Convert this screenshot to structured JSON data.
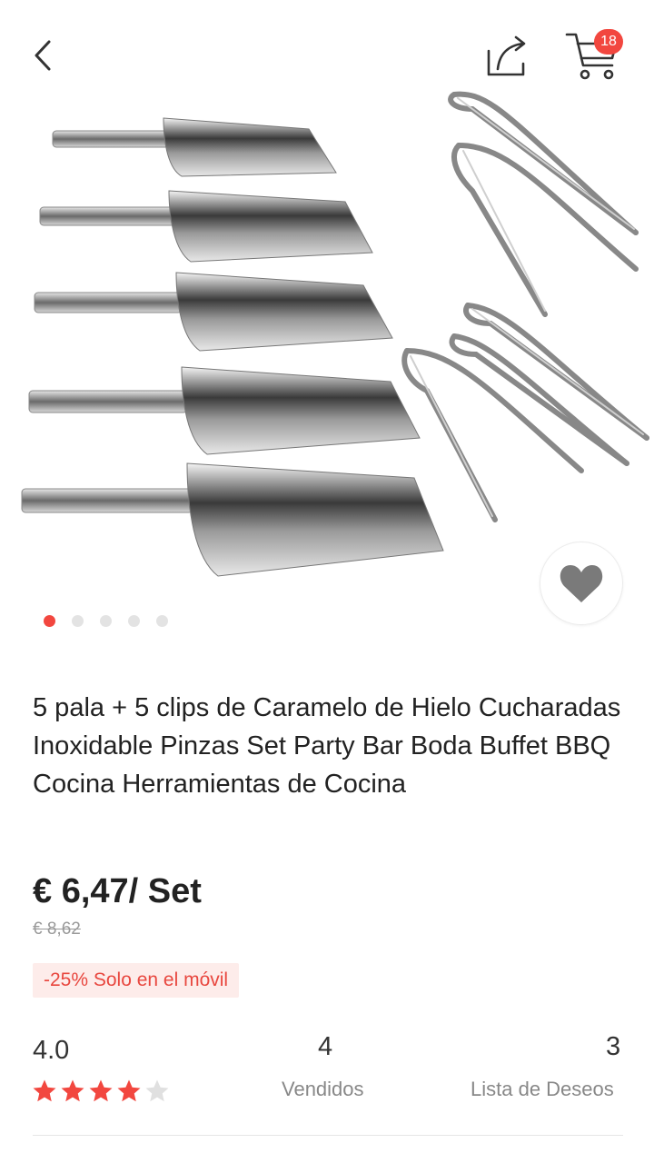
{
  "header": {
    "back_icon": "chevron-left-icon",
    "share_icon": "share-icon",
    "cart_icon": "cart-icon",
    "cart_count": "18"
  },
  "gallery": {
    "image_description": "set of stainless steel scoops and tongs",
    "total_images": 5,
    "active_index": 0
  },
  "product": {
    "title": "5 pala + 5 clips de Caramelo de Hielo Cucharadas Inoxidable Pinzas Set Party Bar Boda Buffet BBQ Cocina Herramientas de Cocina",
    "price": "€ 6,47/ Set",
    "old_price": "€ 8,62",
    "promo": "-25% Solo en el móvil"
  },
  "stats": {
    "rating": "4.0",
    "stars_filled": 4,
    "stars_total": 5,
    "sold_count": "4",
    "sold_label": "Vendidos",
    "wishlist_count": "3",
    "wishlist_label": "Lista de Deseos"
  },
  "colors": {
    "accent": "#f2473f",
    "star_empty": "#e0e0e0",
    "heart": "#7a7a7a"
  }
}
